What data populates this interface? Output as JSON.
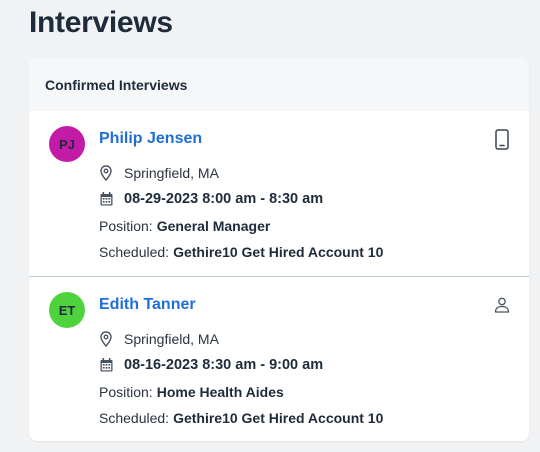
{
  "page": {
    "title": "Interviews"
  },
  "card": {
    "header": "Confirmed Interviews"
  },
  "interviews": [
    {
      "initials": "PJ",
      "avatar_color": "#c41aa8",
      "name": "Philip Jensen",
      "corner_icon": "mobile-phone-icon",
      "location": "Springfield, MA",
      "datetime": "08-29-2023 8:00 am - 8:30 am",
      "position_label": "Position:",
      "position": "General Manager",
      "scheduled_label": "Scheduled:",
      "scheduled": "Gethire10 Get Hired Account 10"
    },
    {
      "initials": "ET",
      "avatar_color": "#4fd33c",
      "name": "Edith Tanner",
      "corner_icon": "person-icon",
      "location": "Springfield, MA",
      "datetime": "08-16-2023 8:30 am - 9:00 am",
      "position_label": "Position:",
      "position": "Home Health Aides",
      "scheduled_label": "Scheduled:",
      "scheduled": "Gethire10 Get Hired Account 10"
    }
  ],
  "colors": {
    "link": "#1f6fd6",
    "divider": "#b9ccd2"
  }
}
